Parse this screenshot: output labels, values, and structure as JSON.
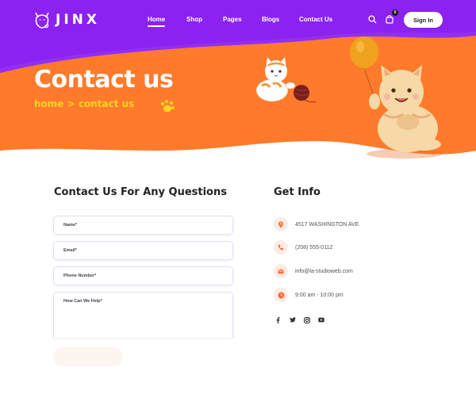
{
  "brand": {
    "name": "JINX"
  },
  "nav": {
    "items": [
      {
        "label": "Home",
        "active": true
      },
      {
        "label": "Shop",
        "active": false
      },
      {
        "label": "Pages",
        "active": false
      },
      {
        "label": "Blogs",
        "active": false
      },
      {
        "label": "Contact Us",
        "active": false
      }
    ],
    "cart_count": "0",
    "signin_label": "Sign In"
  },
  "hero": {
    "title": "Contact us",
    "breadcrumb": "home > contact us"
  },
  "form": {
    "title": "Contact Us For Any Questions",
    "fields": [
      {
        "placeholder": "Name*"
      },
      {
        "placeholder": "Email*"
      },
      {
        "placeholder": "Phone Number*"
      },
      {
        "placeholder": "How Can We Help*"
      }
    ]
  },
  "info": {
    "title": "Get Info",
    "items": [
      {
        "icon": "location-pin-icon",
        "text": "4517 WASHINGTON AVE."
      },
      {
        "icon": "phone-icon",
        "text": "(208) 555-0112"
      },
      {
        "icon": "mail-icon",
        "text": "info@la-studioweb.com"
      },
      {
        "icon": "clock-icon",
        "text": "9:00 am - 10:00 pm"
      }
    ],
    "socials": [
      "facebook-icon",
      "twitter-icon",
      "instagram-icon",
      "youtube-icon"
    ]
  },
  "colors": {
    "purple": "#8b22f0",
    "orange": "#ff7a2b",
    "yellow": "#ffd51e",
    "accent": "#ff6b35"
  }
}
